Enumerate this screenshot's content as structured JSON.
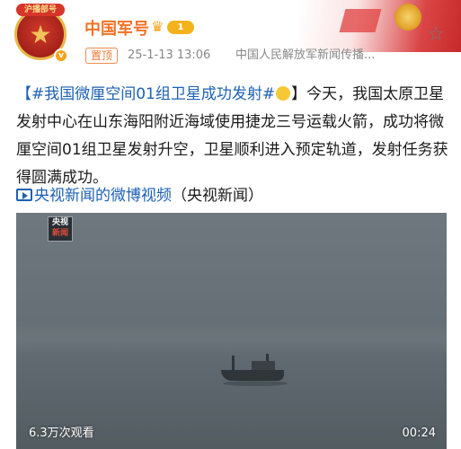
{
  "header": {
    "avatar_tag": "沪播部号",
    "username": "中国军号",
    "level": "1",
    "pin_label": "置顶",
    "timestamp": "25-1-13 13:06",
    "source": "中国人民解放军新闻传播..."
  },
  "post": {
    "hashtag": "【#我国微厘空间01组卫星成功发射#",
    "hashtag_end": "】",
    "body": "今天，我国太原卫星发射中心在山东海阳附近海域使用捷龙三号运载火箭，成功将微厘空间01组卫星发射升空，卫星顺利进入预定轨道，发射任务获得圆满成功。",
    "video_link": "央视新闻的微博视频",
    "video_source": "（央视新闻）"
  },
  "video": {
    "logo_top": "央视",
    "logo_bottom": "新闻",
    "views": "6.3万次观看",
    "duration": "00:24"
  },
  "colors": {
    "username": "#f27326",
    "link": "#1d61b3",
    "pin": "#f07a3a"
  },
  "icons": {
    "favorite": "star-outline-icon",
    "verified": "verified-badge-icon",
    "crown": "crown-icon",
    "video_link": "video-link-icon"
  }
}
